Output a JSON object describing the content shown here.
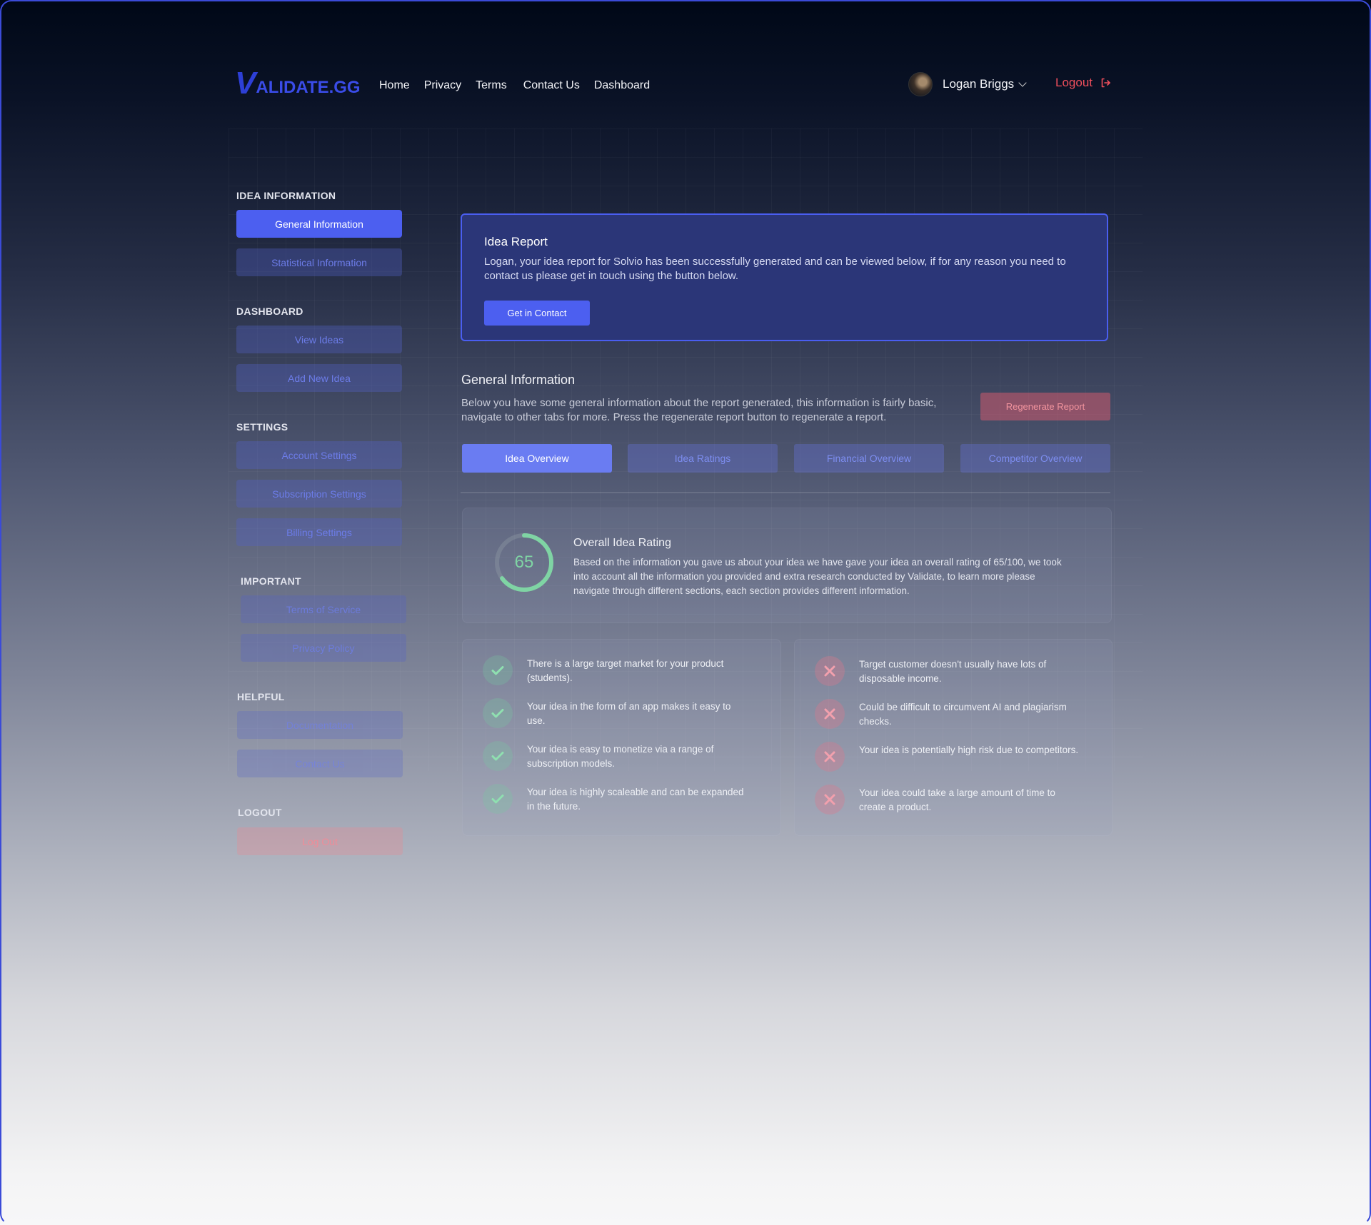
{
  "header": {
    "logo_mark": "V",
    "logo_text": "ALIDATE.GG",
    "nav": [
      "Home",
      "Privacy",
      "Terms",
      "Contact Us",
      "Dashboard"
    ],
    "user_name": "Logan Briggs",
    "logout_label": "Logout"
  },
  "sidebar": {
    "idea_information": {
      "heading": "IDEA INFORMATION",
      "items": [
        "General Information",
        "Statistical Information"
      ]
    },
    "dashboard": {
      "heading": "DASHBOARD",
      "items": [
        "View Ideas",
        "Add New Idea"
      ]
    },
    "settings": {
      "heading": "SETTINGS",
      "items": [
        "Account Settings",
        "Subscription Settings",
        "Billing Settings"
      ]
    },
    "important": {
      "heading": "IMPORTANT",
      "items": [
        "Terms of Service",
        "Privacy Policy"
      ]
    },
    "helpful": {
      "heading": "HELPFUL",
      "items": [
        "Documentation",
        "Contact Us"
      ]
    },
    "logout": {
      "heading": "LOGOUT",
      "items": [
        "Log Out"
      ]
    }
  },
  "report": {
    "title": "Idea Report",
    "text": "Logan, your idea report for Solvio has been successfully generated and can be viewed below, if for any reason you need to contact us please get in touch using the button below.",
    "cta_label": "Get in Contact"
  },
  "general": {
    "title": "General Information",
    "description": "Below you have some general information about the report generated, this information is fairly basic, navigate to other tabs for more. Press the regenerate report button to regenerate a report.",
    "regenerate_label": "Regenerate Report",
    "tabs": [
      "Idea Overview",
      "Idea Ratings",
      "Financial Overview",
      "Competitor Overview"
    ]
  },
  "rating": {
    "score": "65",
    "score_fraction": 0.65,
    "title": "Overall Idea Rating",
    "description": "Based on the information you gave us about your idea we have gave your idea an overall rating of 65/100, we took into account all the information you provided and extra research conducted by Validate, to learn more please navigate through different sections, each section provides different information."
  },
  "pros": [
    "There is a large target market for your product (students).",
    "Your idea in the form of an app makes it easy to use.",
    "Your idea is easy to monetize via a range of subscription models.",
    "Your idea is highly scaleable and can be expanded in the future."
  ],
  "cons": [
    "Target customer doesn't usually have lots of disposable income.",
    "Could be difficult to circumvent AI and plagiarism checks.",
    "Your idea is potentially high risk due to competitors.",
    "Your idea could take a large amount of time to create a product."
  ],
  "colors": {
    "accent": "#4c5ff0",
    "danger": "#ef4f5c",
    "success": "#7fd4a4"
  }
}
